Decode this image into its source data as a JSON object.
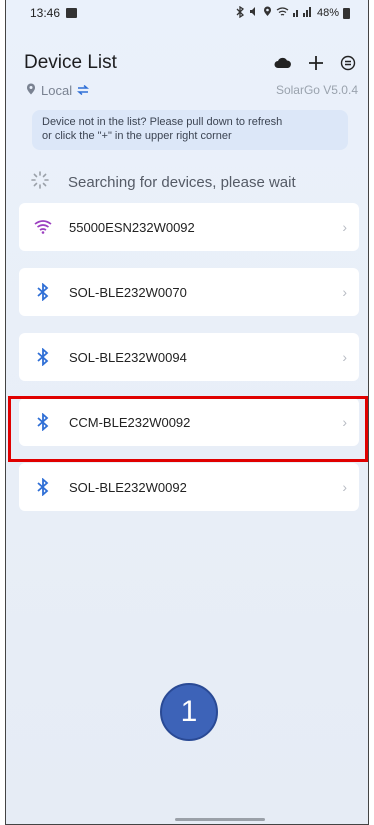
{
  "status_bar": {
    "time": "13:46",
    "right_text": "48%"
  },
  "header": {
    "title": "Device List"
  },
  "subheader": {
    "location": "Local",
    "version": "SolarGo V5.0.4"
  },
  "hint": {
    "line1": "Device not in the list? Please pull down to refresh",
    "line2": "or click the \"+\" in the upper right corner"
  },
  "searching": {
    "text": "Searching for devices, please wait"
  },
  "devices": [
    {
      "name": "55000ESN232W0092",
      "type": "wifi"
    },
    {
      "name": "SOL-BLE232W0070",
      "type": "bluetooth"
    },
    {
      "name": "SOL-BLE232W0094",
      "type": "bluetooth"
    },
    {
      "name": "CCM-BLE232W0092",
      "type": "bluetooth"
    },
    {
      "name": "SOL-BLE232W0092",
      "type": "bluetooth"
    }
  ],
  "step_badge": "1",
  "colors": {
    "accent_blue": "#2f6fd6",
    "wifi_purple": "#9b3fc0",
    "highlight_red": "#e00000",
    "step_circle": "#3d63b8"
  }
}
